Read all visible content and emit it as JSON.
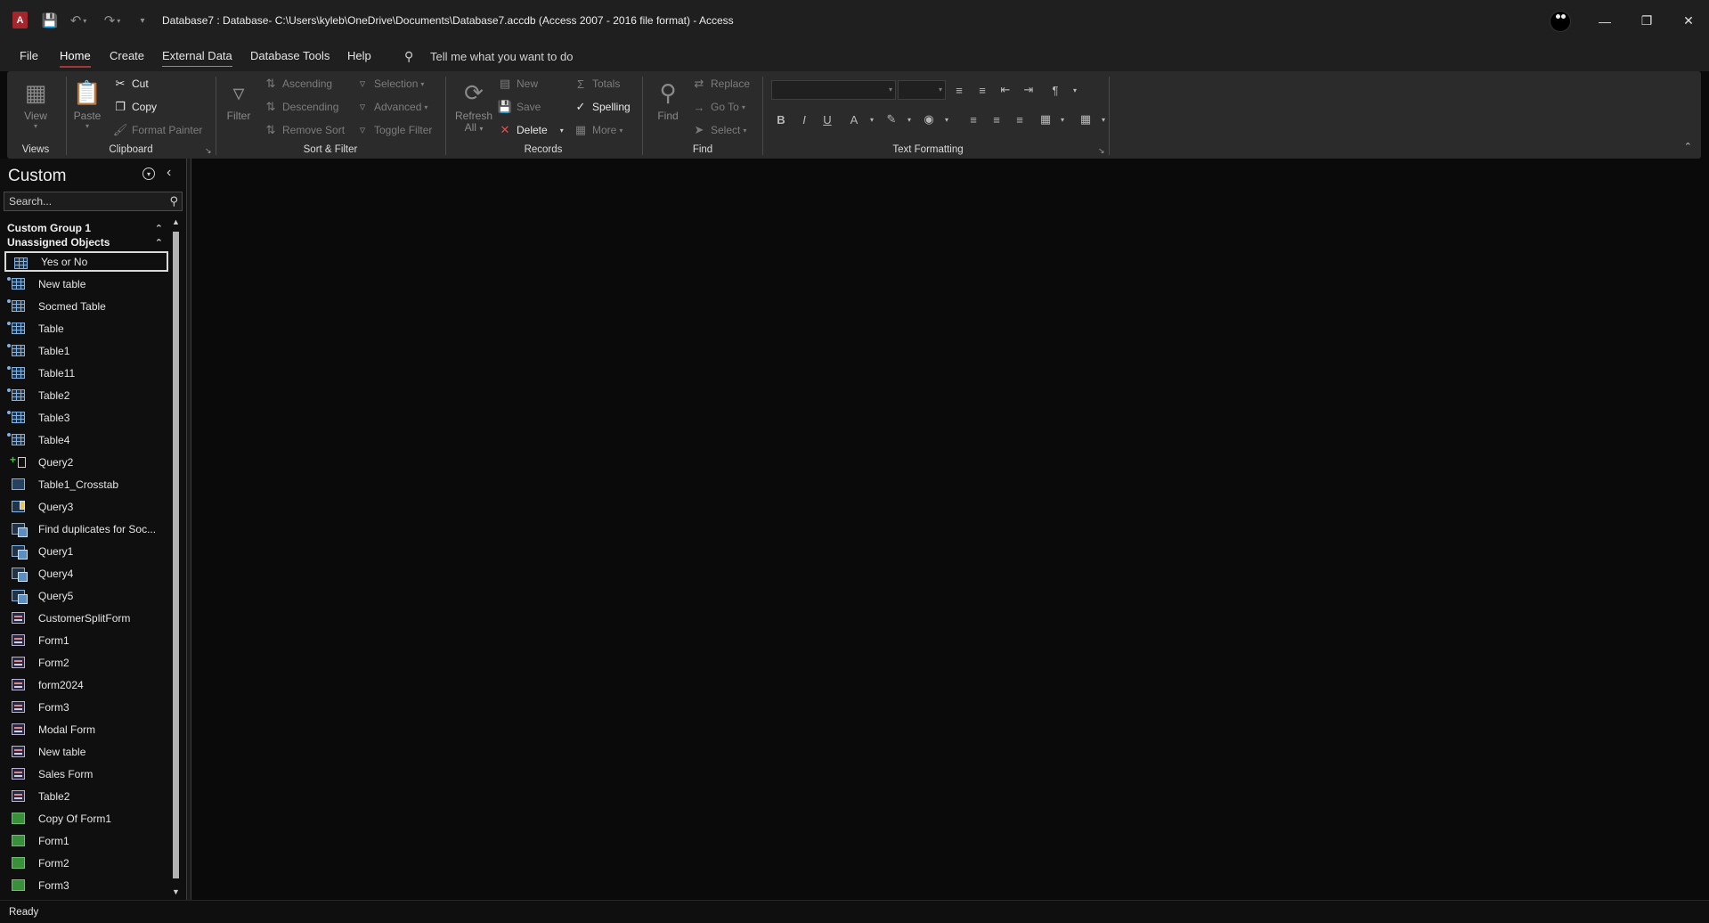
{
  "titlebar": {
    "title": "Database7 : Database- C:\\Users\\kyleb\\OneDrive\\Documents\\Database7.accdb (Access 2007 - 2016 file format)  -  Access",
    "app_logo": "A"
  },
  "tabs": [
    {
      "label": "File"
    },
    {
      "label": "Home"
    },
    {
      "label": "Create"
    },
    {
      "label": "External Data"
    },
    {
      "label": "Database Tools"
    },
    {
      "label": "Help"
    }
  ],
  "tell_me": "Tell me what you want to do",
  "ribbon": {
    "views": {
      "group": "Views",
      "view": "View"
    },
    "clipboard": {
      "group": "Clipboard",
      "paste": "Paste",
      "cut": "Cut",
      "copy": "Copy",
      "format_painter": "Format Painter"
    },
    "sort_filter": {
      "group": "Sort & Filter",
      "filter": "Filter",
      "ascending": "Ascending",
      "descending": "Descending",
      "remove_sort": "Remove Sort",
      "selection": "Selection",
      "advanced": "Advanced",
      "toggle_filter": "Toggle Filter"
    },
    "records": {
      "group": "Records",
      "refresh": "Refresh",
      "refresh_sub": "All",
      "new": "New",
      "save": "Save",
      "delete": "Delete",
      "totals": "Totals",
      "spelling": "Spelling",
      "more": "More"
    },
    "find": {
      "group": "Find",
      "find": "Find",
      "replace": "Replace",
      "goto": "Go To",
      "select": "Select"
    },
    "text_formatting": {
      "group": "Text Formatting"
    }
  },
  "nav": {
    "title": "Custom",
    "search_placeholder": "Search...",
    "groups": [
      {
        "label": "Custom Group 1"
      },
      {
        "label": "Unassigned Objects"
      }
    ],
    "items": [
      {
        "label": "Yes or No",
        "type": "table"
      },
      {
        "label": "New table",
        "type": "linked-table"
      },
      {
        "label": "Socmed Table",
        "type": "linked-table"
      },
      {
        "label": "Table",
        "type": "linked-table"
      },
      {
        "label": "Table1",
        "type": "linked-table"
      },
      {
        "label": "Table11",
        "type": "linked-table"
      },
      {
        "label": "Table2",
        "type": "linked-table"
      },
      {
        "label": "Table3",
        "type": "linked-table"
      },
      {
        "label": "Table4",
        "type": "linked-table"
      },
      {
        "label": "Query2",
        "type": "append-query"
      },
      {
        "label": "Table1_Crosstab",
        "type": "crosstab-query"
      },
      {
        "label": "Query3",
        "type": "make-table-query"
      },
      {
        "label": "Find duplicates for Soc...",
        "type": "query"
      },
      {
        "label": "Query1",
        "type": "query"
      },
      {
        "label": "Query4",
        "type": "query"
      },
      {
        "label": "Query5",
        "type": "query"
      },
      {
        "label": "CustomerSplitForm",
        "type": "form"
      },
      {
        "label": "Form1",
        "type": "form"
      },
      {
        "label": "Form2",
        "type": "form"
      },
      {
        "label": "form2024",
        "type": "form"
      },
      {
        "label": "Form3",
        "type": "form"
      },
      {
        "label": "Modal Form",
        "type": "form"
      },
      {
        "label": "New table",
        "type": "form"
      },
      {
        "label": "Sales Form",
        "type": "form"
      },
      {
        "label": "Table2",
        "type": "form"
      },
      {
        "label": "Copy Of Form1",
        "type": "report"
      },
      {
        "label": "Form1",
        "type": "report"
      },
      {
        "label": "Form2",
        "type": "report"
      },
      {
        "label": "Form3",
        "type": "report"
      }
    ]
  },
  "status": {
    "text": "Ready"
  },
  "colors": {
    "accent": "#a4373a",
    "background": "#0a0a0a",
    "ribbon": "#2b2b2b",
    "titlebar": "#1f1f1f"
  }
}
